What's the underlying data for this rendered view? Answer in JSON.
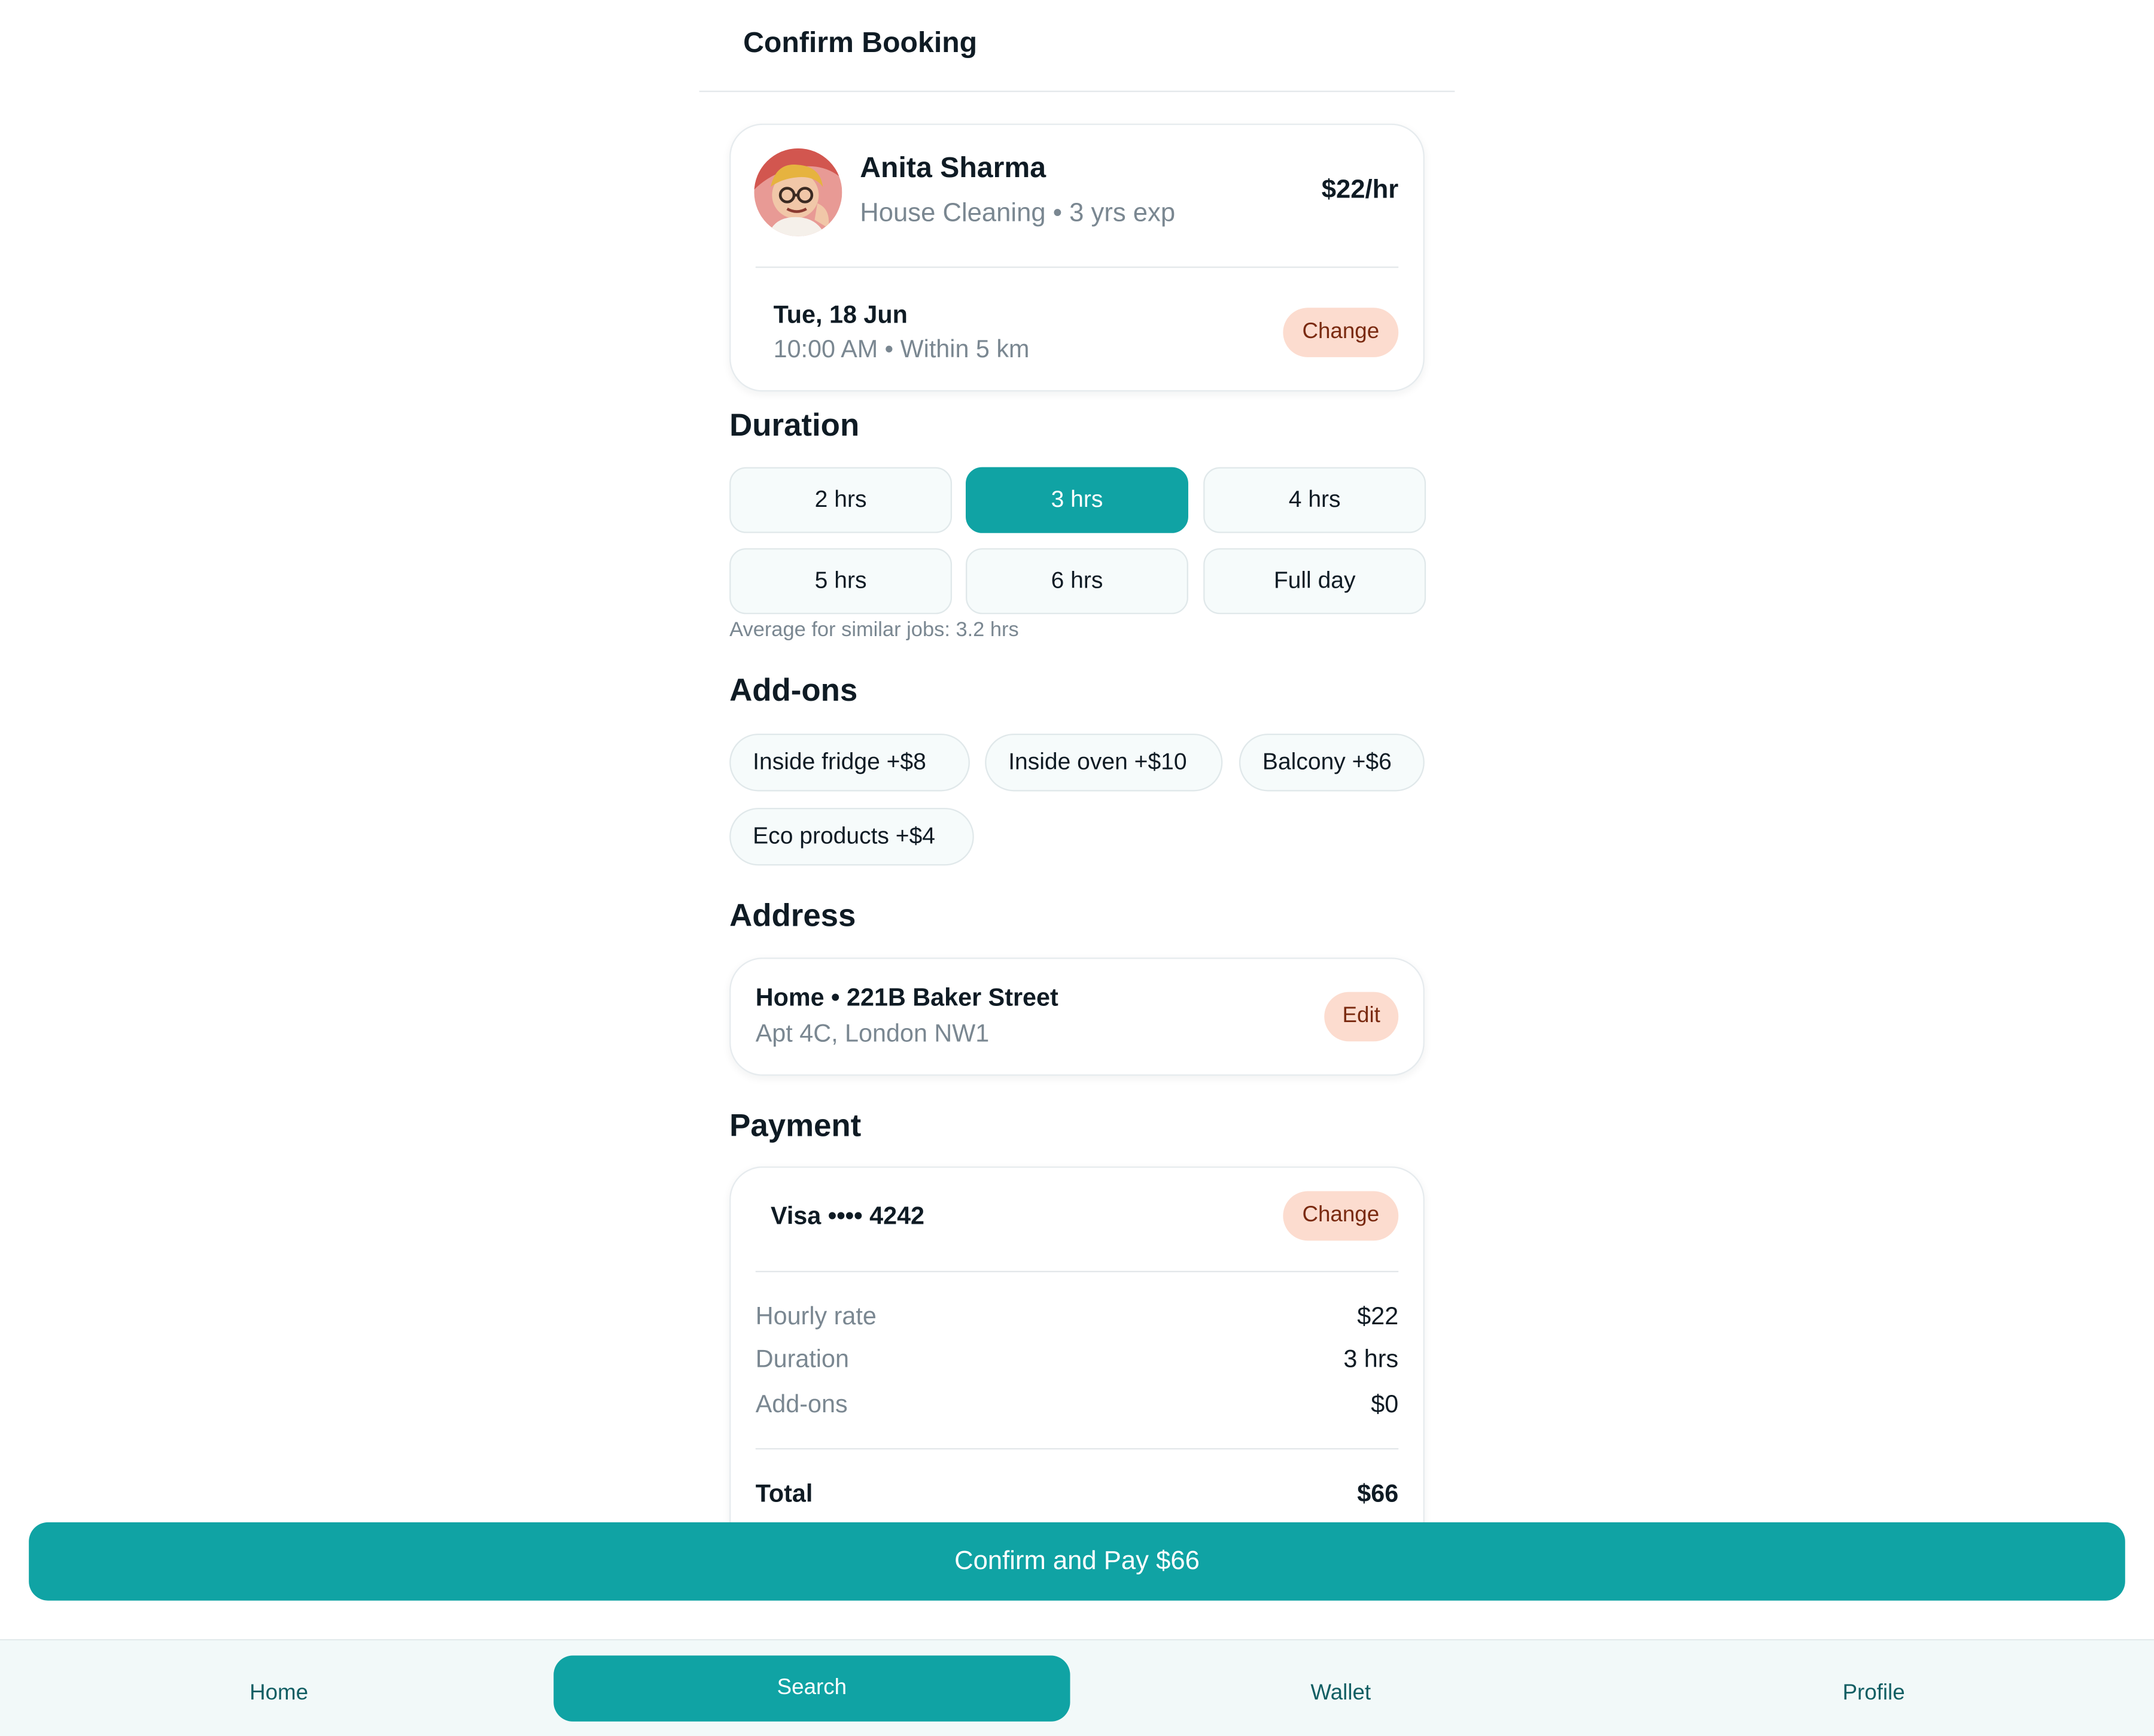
{
  "header": {
    "title": "Confirm Booking"
  },
  "provider": {
    "name": "Anita Sharma",
    "subtitle": "House Cleaning • 3 yrs exp",
    "rate": "$22/hr",
    "date": "Tue, 18 Jun",
    "time_detail": "10:00 AM • Within 5 km",
    "change_label": "Change"
  },
  "duration": {
    "title": "Duration",
    "options": [
      "2 hrs",
      "3 hrs",
      "4 hrs",
      "5 hrs",
      "6 hrs",
      "Full day"
    ],
    "selected": "3 hrs",
    "hint": "Average for similar jobs: 3.2 hrs"
  },
  "addons": {
    "title": "Add-ons",
    "items": [
      "Inside fridge +$8",
      "Inside oven +$10",
      "Balcony +$6",
      "Eco products +$4"
    ]
  },
  "address": {
    "title": "Address",
    "line1": "Home • 221B Baker Street",
    "line2": "Apt 4C, London NW1",
    "edit_label": "Edit"
  },
  "payment": {
    "title": "Payment",
    "card_label": "Visa •••• 4242",
    "change_label": "Change",
    "rows": [
      {
        "label": "Hourly rate",
        "value": "$22"
      },
      {
        "label": "Duration",
        "value": "3 hrs"
      },
      {
        "label": "Add-ons",
        "value": "$0"
      }
    ],
    "total_label": "Total",
    "total_value": "$66"
  },
  "confirm_button": "Confirm and Pay $66",
  "nav": {
    "items": [
      "Home",
      "Search",
      "Wallet",
      "Profile"
    ],
    "active": "Search"
  },
  "colors": {
    "accent": "#10a3a4",
    "chip_peach": "#fcdccf",
    "muted_text": "#7a8791"
  }
}
